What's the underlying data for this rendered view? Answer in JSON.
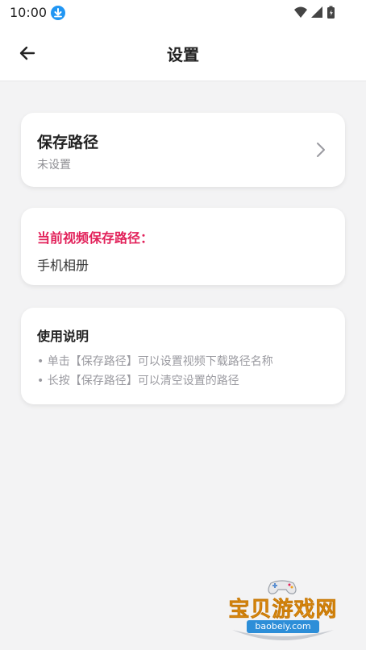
{
  "status_bar": {
    "time": "10:00"
  },
  "header": {
    "title": "设置"
  },
  "save_path_card": {
    "title": "保存路径",
    "subtitle": "未设置"
  },
  "current_path_card": {
    "label": "当前视频保存路径：",
    "value": "手机相册"
  },
  "instructions_card": {
    "heading": "使用说明",
    "lines": [
      "• 单击【保存路径】可以设置视频下载路径名称",
      "• 长按【保存路径】可以清空设置的路径"
    ]
  },
  "watermark": {
    "brand": "宝贝游戏网",
    "url": "baobeiy.com"
  },
  "colors": {
    "accent_red": "#e2215a",
    "download_badge": "#2196f3",
    "background": "#f3f3f4"
  }
}
